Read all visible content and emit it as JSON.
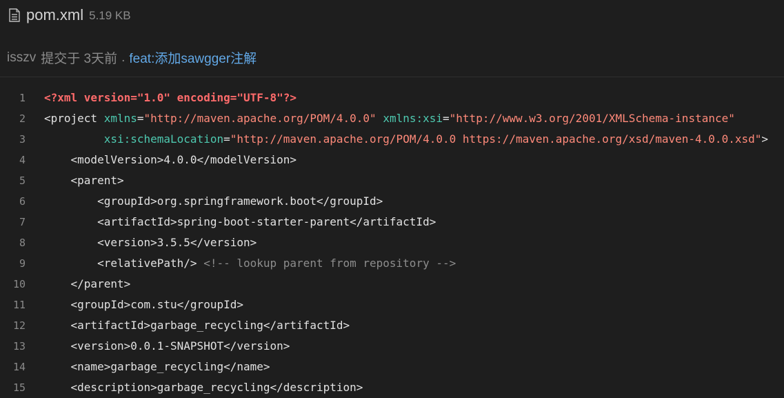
{
  "file": {
    "icon": "file-lines-icon",
    "name": "pom.xml",
    "size": "5.19 KB"
  },
  "commit": {
    "author": "isszv",
    "text": "提交于 3天前",
    "separator": ".",
    "message": "feat:添加sawgger注解"
  },
  "colors": {
    "background": "#1e1e1e",
    "declaration": "#ff6b6b",
    "attribute": "#4ec9b0",
    "value": "#ff8a7a",
    "comment": "#8d8d8d",
    "link": "#62a8e6"
  },
  "code": {
    "lines": [
      {
        "n": "1",
        "t": [
          [
            "decl",
            "<?xml version=\"1.0\" encoding=\"UTF-8\"?>"
          ]
        ]
      },
      {
        "n": "2",
        "t": [
          [
            "tag",
            "<project "
          ],
          [
            "attr",
            "xmlns"
          ],
          [
            "tag",
            "="
          ],
          [
            "val",
            "\"http://maven.apache.org/POM/4.0.0\""
          ],
          [
            "tag",
            " "
          ],
          [
            "attr",
            "xmlns:xsi"
          ],
          [
            "tag",
            "="
          ],
          [
            "val",
            "\"http://www.w3.org/2001/XMLSchema-instance\""
          ]
        ]
      },
      {
        "n": "3",
        "t": [
          [
            "tag",
            "         "
          ],
          [
            "attr",
            "xsi:schemaLocation"
          ],
          [
            "tag",
            "="
          ],
          [
            "val",
            "\"http://maven.apache.org/POM/4.0.0 https://maven.apache.org/xsd/maven-4.0.0.xsd\""
          ],
          [
            "tag",
            ">"
          ]
        ]
      },
      {
        "n": "4",
        "t": [
          [
            "tag",
            "    <modelVersion>4.0.0</modelVersion>"
          ]
        ]
      },
      {
        "n": "5",
        "t": [
          [
            "tag",
            "    <parent>"
          ]
        ]
      },
      {
        "n": "6",
        "t": [
          [
            "tag",
            "        <groupId>org.springframework.boot</groupId>"
          ]
        ]
      },
      {
        "n": "7",
        "t": [
          [
            "tag",
            "        <artifactId>spring-boot-starter-parent</artifactId>"
          ]
        ]
      },
      {
        "n": "8",
        "t": [
          [
            "tag",
            "        <version>3.5.5</version>"
          ]
        ]
      },
      {
        "n": "9",
        "t": [
          [
            "tag",
            "        <relativePath/> "
          ],
          [
            "com",
            "<!-- lookup parent from repository -->"
          ]
        ]
      },
      {
        "n": "10",
        "t": [
          [
            "tag",
            "    </parent>"
          ]
        ]
      },
      {
        "n": "11",
        "t": [
          [
            "tag",
            "    <groupId>com.stu</groupId>"
          ]
        ]
      },
      {
        "n": "12",
        "t": [
          [
            "tag",
            "    <artifactId>garbage_recycling</artifactId>"
          ]
        ]
      },
      {
        "n": "13",
        "t": [
          [
            "tag",
            "    <version>0.0.1-SNAPSHOT</version>"
          ]
        ]
      },
      {
        "n": "14",
        "t": [
          [
            "tag",
            "    <name>garbage_recycling</name>"
          ]
        ]
      },
      {
        "n": "15",
        "t": [
          [
            "tag",
            "    <description>garbage_recycling</description>"
          ]
        ]
      }
    ]
  }
}
